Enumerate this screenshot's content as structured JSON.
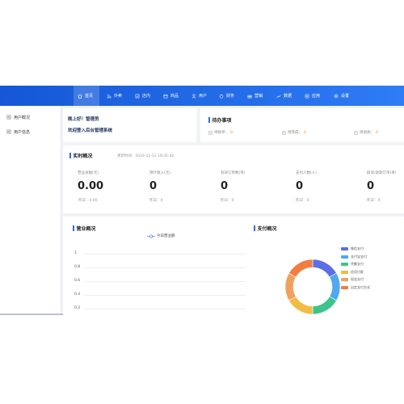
{
  "nav": {
    "items": [
      {
        "label": "首页",
        "icon": "home-icon",
        "active": true
      },
      {
        "label": "外卖",
        "icon": "delivery-icon"
      },
      {
        "label": "店内",
        "icon": "store-icon"
      },
      {
        "label": "商品",
        "icon": "goods-icon"
      },
      {
        "label": "用户",
        "icon": "user-icon"
      },
      {
        "label": "财务",
        "icon": "finance-icon"
      },
      {
        "label": "营销",
        "icon": "marketing-icon"
      },
      {
        "label": "数据",
        "icon": "data-icon"
      },
      {
        "label": "应用",
        "icon": "apps-icon"
      },
      {
        "label": "设置",
        "icon": "settings-icon"
      }
    ],
    "colors": {
      "start": "#1557d6",
      "end": "#2f7cf5"
    }
  },
  "sidebar": {
    "items": [
      {
        "label": "用户概况",
        "icon": "user-overview-icon"
      },
      {
        "label": "用户信息",
        "icon": "user-info-icon"
      }
    ]
  },
  "welcome": {
    "line1": "晚上好！管理员",
    "line2": "欢迎登入后台管理系统"
  },
  "todo": {
    "title": "待办事项",
    "items": [
      {
        "label": "待接单：",
        "count": "0"
      },
      {
        "label": "待完成：",
        "count": "0"
      },
      {
        "label": "待退款：",
        "count": "0"
      }
    ]
  },
  "realtime": {
    "title": "实时概况",
    "update_time": "更新时间：2024-11-12 18:31:42",
    "stats": [
      {
        "label": "营业总额(元)",
        "value": "0.00",
        "sub": "昨日：0.00"
      },
      {
        "label": "预计收入(元)",
        "value": "0",
        "sub": "昨日：0"
      },
      {
        "label": "有效订单数(单)",
        "value": "0",
        "sub": "昨日：0"
      },
      {
        "label": "支付人数(人)",
        "value": "0",
        "sub": "昨日：0"
      },
      {
        "label": "取消/退款订单(单)",
        "value": "0",
        "sub": "昨日：0"
      }
    ]
  },
  "revenue": {
    "title": "营业概况",
    "legend": "今日营业额",
    "y_ticks": [
      "1",
      "0.8",
      "0.6",
      "0.4",
      "0.2"
    ]
  },
  "payment": {
    "title": "支付概况",
    "slices": [
      {
        "name": "微信支付",
        "value": 1,
        "color": "#5b6fe6"
      },
      {
        "name": "支付宝支付",
        "value": 1,
        "color": "#4ea8f2"
      },
      {
        "name": "余额支付",
        "value": 1,
        "color": "#3cc58a"
      },
      {
        "name": "信用付款",
        "value": 1,
        "color": "#f2bb43"
      },
      {
        "name": "现金支付",
        "value": 1,
        "color": "#f0a15e"
      },
      {
        "name": "自定支付方式",
        "value": 1,
        "color": "#f37c40"
      }
    ]
  }
}
